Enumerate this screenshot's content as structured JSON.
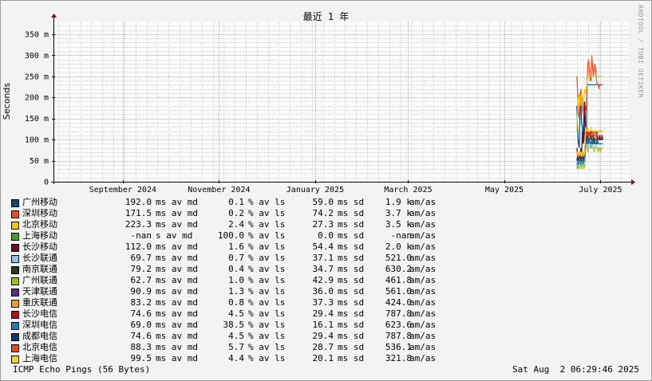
{
  "chart_data": {
    "type": "line",
    "title": "最近 1 年",
    "ylabel": "Seconds",
    "ylim": [
      0,
      0.38
    ],
    "yticks": [
      {
        "value": 0,
        "label": "0"
      },
      {
        "value": 0.05,
        "label": "50 m"
      },
      {
        "value": 0.1,
        "label": "100 m"
      },
      {
        "value": 0.15,
        "label": "150 m"
      },
      {
        "value": 0.2,
        "label": "200 m"
      },
      {
        "value": 0.25,
        "label": "250 m"
      },
      {
        "value": 0.3,
        "label": "300 m"
      },
      {
        "value": 0.35,
        "label": "350 m"
      }
    ],
    "xlim": [
      "2024-08-02",
      "2025-08-02"
    ],
    "xticks": [
      {
        "date": "2024-09-15",
        "label": "September 2024"
      },
      {
        "date": "2024-11-15",
        "label": "November 2024"
      },
      {
        "date": "2025-01-15",
        "label": "January 2025"
      },
      {
        "date": "2025-03-15",
        "label": "March 2025"
      },
      {
        "date": "2025-05-15",
        "label": "May 2025"
      },
      {
        "date": "2025-07-15",
        "label": "July 2025"
      }
    ],
    "grid": true,
    "series": [
      {
        "name": "广州移动",
        "color": "#0b4b83",
        "start": "2025-06-30",
        "values": [
          0.18,
          0.12,
          0.09,
          0.08,
          0.16,
          0.2,
          0.14,
          0.13,
          0.1,
          0.16,
          0.11,
          0.12,
          0.1,
          0.23,
          0.23,
          0.23,
          0.23,
          0.23,
          0.23,
          0.23,
          0.23,
          0.23,
          0.23,
          0.23,
          0.23,
          0.23,
          0.23,
          0.23,
          0.23,
          0.23,
          0.23,
          0.23,
          0.23,
          0.23
        ]
      },
      {
        "name": "深圳移动",
        "color": "#ea4d20",
        "start": "2025-06-30",
        "values": [
          0.25,
          0.21,
          0.16,
          0.15,
          0.2,
          0.22,
          0.2,
          0.18,
          0.16,
          0.19,
          0.16,
          0.18,
          0.17,
          0.24,
          0.28,
          0.29,
          0.26,
          0.24,
          0.24,
          0.3,
          0.27,
          0.25,
          0.27,
          0.28,
          0.26,
          0.24,
          0.23,
          0.23,
          0.22,
          0.23,
          0.23,
          0.23,
          0.23,
          0.23
        ]
      },
      {
        "name": "北京移动",
        "color": "#f2c600",
        "start": "2025-06-30",
        "values": [
          0.12,
          0.17,
          0.2,
          0.21,
          0.19,
          0.18,
          0.21,
          0.2,
          0.19,
          0.2,
          0.22,
          0.21,
          0.22,
          0.24,
          0.25,
          0.25,
          0.25,
          0.25,
          0.25,
          0.25,
          0.25,
          0.25,
          0.25,
          0.25,
          0.25,
          0.25,
          0.25,
          0.25,
          0.25,
          0.25,
          0.25,
          0.25,
          0.25,
          0.25
        ]
      },
      {
        "name": "上海移动",
        "color": "#4c9a2a",
        "start": "2025-06-30",
        "values": []
      },
      {
        "name": "长沙移动",
        "color": "#6b0a1c",
        "start": "2025-06-30",
        "values": [
          0.08,
          0.06,
          0.05,
          0.07,
          0.06,
          0.08,
          0.06,
          0.12,
          0.09,
          0.1,
          0.19,
          0.13,
          0.11,
          0.1,
          0.12,
          0.1,
          0.11,
          0.11,
          0.12,
          0.1,
          0.11,
          0.1,
          0.09,
          0.1,
          0.11,
          0.1,
          0.11,
          0.1,
          0.1,
          0.11,
          0.1,
          0.1,
          0.11,
          0.1
        ]
      },
      {
        "name": "长沙联通",
        "color": "#8ec3ee",
        "start": "2025-06-30",
        "values": [
          0.03,
          0.04,
          0.05,
          0.04,
          0.05,
          0.05,
          0.04,
          0.05,
          0.04,
          0.05,
          0.06,
          0.1,
          0.09,
          0.08,
          0.09,
          0.08,
          0.08,
          0.09,
          0.08,
          0.08,
          0.09,
          0.08,
          0.08,
          0.08,
          0.09,
          0.08,
          0.08,
          0.08,
          0.08,
          0.08,
          0.08,
          0.08,
          0.08,
          0.08
        ]
      },
      {
        "name": "南京联通",
        "color": "#2b3b16",
        "start": "2025-06-30",
        "values": [
          0.05,
          0.06,
          0.05,
          0.06,
          0.05,
          0.05,
          0.06,
          0.05,
          0.05,
          0.06,
          0.06,
          0.1,
          0.1,
          0.09,
          0.1,
          0.09,
          0.1,
          0.09,
          0.09,
          0.1,
          0.09,
          0.09,
          0.1,
          0.09,
          0.09,
          0.09,
          0.1,
          0.09,
          0.09,
          0.09,
          0.09,
          0.09,
          0.09,
          0.09
        ]
      },
      {
        "name": "广州联通",
        "color": "#9cc41b",
        "start": "2025-06-30",
        "values": [
          0.04,
          0.03,
          0.04,
          0.03,
          0.04,
          0.04,
          0.03,
          0.04,
          0.04,
          0.03,
          0.04,
          0.09,
          0.08,
          0.08,
          0.07,
          0.08,
          0.08,
          0.08,
          0.09,
          0.08,
          0.08,
          0.08,
          0.07,
          0.08,
          0.08,
          0.08,
          0.08,
          0.07,
          0.08,
          0.08,
          0.07,
          0.08,
          0.08,
          0.08
        ]
      },
      {
        "name": "天津联通",
        "color": "#5a2d87",
        "start": "2025-06-30",
        "values": [
          0.06,
          0.07,
          0.06,
          0.07,
          0.06,
          0.07,
          0.06,
          0.07,
          0.07,
          0.06,
          0.07,
          0.11,
          0.1,
          0.1,
          0.11,
          0.1,
          0.1,
          0.11,
          0.1,
          0.1,
          0.1,
          0.11,
          0.1,
          0.1,
          0.1,
          0.1,
          0.1,
          0.1,
          0.1,
          0.1,
          0.1,
          0.1,
          0.1,
          0.1
        ]
      },
      {
        "name": "重庆联通",
        "color": "#f79a29",
        "start": "2025-06-30",
        "values": [
          0.05,
          0.06,
          0.06,
          0.05,
          0.06,
          0.06,
          0.05,
          0.06,
          0.06,
          0.05,
          0.06,
          0.11,
          0.1,
          0.11,
          0.1,
          0.1,
          0.11,
          0.1,
          0.1,
          0.11,
          0.1,
          0.1,
          0.1,
          0.1,
          0.11,
          0.1,
          0.1,
          0.1,
          0.1,
          0.1,
          0.1,
          0.1,
          0.1,
          0.1
        ]
      },
      {
        "name": "长沙电信",
        "color": "#b2111b",
        "start": "2025-06-30",
        "values": [
          0.05,
          0.06,
          0.05,
          0.06,
          0.06,
          0.05,
          0.06,
          0.06,
          0.05,
          0.06,
          0.06,
          0.12,
          0.11,
          0.12,
          0.12,
          0.11,
          0.12,
          0.12,
          0.11,
          0.12,
          0.12,
          0.11,
          0.12,
          0.12,
          0.12,
          0.11,
          0.12,
          0.12,
          0.12,
          0.12,
          0.12,
          0.12,
          0.12,
          0.12
        ]
      },
      {
        "name": "深圳电信",
        "color": "#1a7fc2",
        "start": "2025-06-30",
        "values": [
          0.04,
          0.05,
          0.04,
          0.05,
          0.05,
          0.04,
          0.05,
          0.05,
          0.04,
          0.05,
          0.05,
          0.09,
          0.09,
          0.1,
          0.09,
          0.09,
          0.1,
          0.09,
          0.09,
          0.09,
          0.1,
          0.09,
          0.09,
          0.09,
          0.09,
          0.1,
          0.09,
          0.09,
          0.09,
          0.09,
          0.09,
          0.09,
          0.09,
          0.09
        ]
      },
      {
        "name": "成都电信",
        "color": "#0d3a6e",
        "start": "2025-06-30",
        "values": [
          0.05,
          0.06,
          0.05,
          0.06,
          0.06,
          0.05,
          0.06,
          0.06,
          0.05,
          0.06,
          0.06,
          0.1,
          0.1,
          0.11,
          0.1,
          0.1,
          0.1,
          0.1,
          0.11,
          0.1,
          0.1,
          0.1,
          0.1,
          0.1,
          0.1,
          0.1,
          0.1,
          0.1,
          0.1,
          0.1,
          0.1,
          0.1,
          0.1,
          0.1
        ]
      },
      {
        "name": "北京电信",
        "color": "#e84a1e",
        "start": "2025-06-30",
        "values": [
          0.06,
          0.07,
          0.06,
          0.07,
          0.07,
          0.06,
          0.07,
          0.07,
          0.06,
          0.07,
          0.07,
          0.12,
          0.11,
          0.11,
          0.12,
          0.11,
          0.11,
          0.12,
          0.11,
          0.11,
          0.11,
          0.12,
          0.11,
          0.11,
          0.11,
          0.11,
          0.11,
          0.11,
          0.11,
          0.11,
          0.11,
          0.11,
          0.11,
          0.11
        ]
      },
      {
        "name": "上海电信",
        "color": "#f7d528",
        "start": "2025-06-30",
        "values": [
          0.06,
          0.07,
          0.07,
          0.06,
          0.07,
          0.07,
          0.06,
          0.07,
          0.07,
          0.06,
          0.07,
          0.13,
          0.12,
          0.12,
          0.13,
          0.12,
          0.12,
          0.12,
          0.13,
          0.12,
          0.12,
          0.12,
          0.12,
          0.12,
          0.12,
          0.12,
          0.12,
          0.12,
          0.12,
          0.12,
          0.12,
          0.12,
          0.12,
          0.12
        ]
      }
    ]
  },
  "watermark": "RRDTOOL / TOBI OETIKER",
  "legend": [
    {
      "name": "广州移动",
      "color": "#0b4b83",
      "median": "192.0",
      "unit": "ms av md",
      "loss": "0.1",
      "loss_unit": "% av ls",
      "sd": "59.0",
      "sd_unit": "ms sd",
      "amas": "1.9 k",
      "amas_unit": "am/as"
    },
    {
      "name": "深圳移动",
      "color": "#ea4d20",
      "median": "171.5",
      "unit": "ms av md",
      "loss": "0.2",
      "loss_unit": "% av ls",
      "sd": "74.2",
      "sd_unit": "ms sd",
      "amas": "3.7 k",
      "amas_unit": "am/as"
    },
    {
      "name": "北京移动",
      "color": "#f2c600",
      "median": "223.3",
      "unit": "ms av md",
      "loss": "2.4",
      "loss_unit": "% av ls",
      "sd": "27.3",
      "sd_unit": "ms sd",
      "amas": "3.5 k",
      "amas_unit": "am/as"
    },
    {
      "name": "上海移动",
      "color": "#4c9a2a",
      "median": "-nan",
      "unit": "s av md",
      "loss": "100.0",
      "loss_unit": "% av ls",
      "sd": "0.0",
      "sd_unit": "ms sd",
      "amas": "-nan",
      "amas_unit": "am/as"
    },
    {
      "name": "长沙移动",
      "color": "#6b0a1c",
      "median": "112.0",
      "unit": "ms av md",
      "loss": "1.6",
      "loss_unit": "% av ls",
      "sd": "54.4",
      "sd_unit": "ms sd",
      "amas": "2.0 k",
      "amas_unit": "am/as"
    },
    {
      "name": "长沙联通",
      "color": "#8ec3ee",
      "median": "69.7",
      "unit": "ms av md",
      "loss": "0.7",
      "loss_unit": "% av ls",
      "sd": "37.1",
      "sd_unit": "ms sd",
      "amas": "521.0",
      "amas_unit": "am/as"
    },
    {
      "name": "南京联通",
      "color": "#2b3b16",
      "median": "79.2",
      "unit": "ms av md",
      "loss": "0.4",
      "loss_unit": "% av ls",
      "sd": "34.7",
      "sd_unit": "ms sd",
      "amas": "630.2",
      "amas_unit": "am/as"
    },
    {
      "name": "广州联通",
      "color": "#9cc41b",
      "median": "62.7",
      "unit": "ms av md",
      "loss": "1.0",
      "loss_unit": "% av ls",
      "sd": "42.9",
      "sd_unit": "ms sd",
      "amas": "461.8",
      "amas_unit": "am/as"
    },
    {
      "name": "天津联通",
      "color": "#5a2d87",
      "median": "90.9",
      "unit": "ms av md",
      "loss": "1.3",
      "loss_unit": "% av ls",
      "sd": "36.0",
      "sd_unit": "ms sd",
      "amas": "561.0",
      "amas_unit": "am/as"
    },
    {
      "name": "重庆联通",
      "color": "#f79a29",
      "median": "83.2",
      "unit": "ms av md",
      "loss": "0.8",
      "loss_unit": "% av ls",
      "sd": "37.3",
      "sd_unit": "ms sd",
      "amas": "424.0",
      "amas_unit": "am/as"
    },
    {
      "name": "长沙电信",
      "color": "#b2111b",
      "median": "74.6",
      "unit": "ms av md",
      "loss": "4.5",
      "loss_unit": "% av ls",
      "sd": "29.4",
      "sd_unit": "ms sd",
      "amas": "787.8",
      "amas_unit": "am/as"
    },
    {
      "name": "深圳电信",
      "color": "#1a7fc2",
      "median": "69.0",
      "unit": "ms av md",
      "loss": "38.5",
      "loss_unit": "% av ls",
      "sd": "16.1",
      "sd_unit": "ms sd",
      "amas": "623.6",
      "amas_unit": "am/as"
    },
    {
      "name": "成都电信",
      "color": "#0d3a6e",
      "median": "74.6",
      "unit": "ms av md",
      "loss": "4.5",
      "loss_unit": "% av ls",
      "sd": "29.4",
      "sd_unit": "ms sd",
      "amas": "787.8",
      "amas_unit": "am/as"
    },
    {
      "name": "北京电信",
      "color": "#e84a1e",
      "median": "88.3",
      "unit": "ms av md",
      "loss": "5.7",
      "loss_unit": "% av ls",
      "sd": "28.7",
      "sd_unit": "ms sd",
      "amas": "536.1",
      "amas_unit": "am/as"
    },
    {
      "name": "上海电信",
      "color": "#f7d528",
      "median": "99.5",
      "unit": "ms av md",
      "loss": "4.4",
      "loss_unit": "% av ls",
      "sd": "20.1",
      "sd_unit": "ms sd",
      "amas": "321.8",
      "amas_unit": "am/as"
    }
  ],
  "footer": {
    "left": "ICMP Echo Pings (56 Bytes)",
    "right": "Sat Aug  2 06:29:46 2025"
  }
}
